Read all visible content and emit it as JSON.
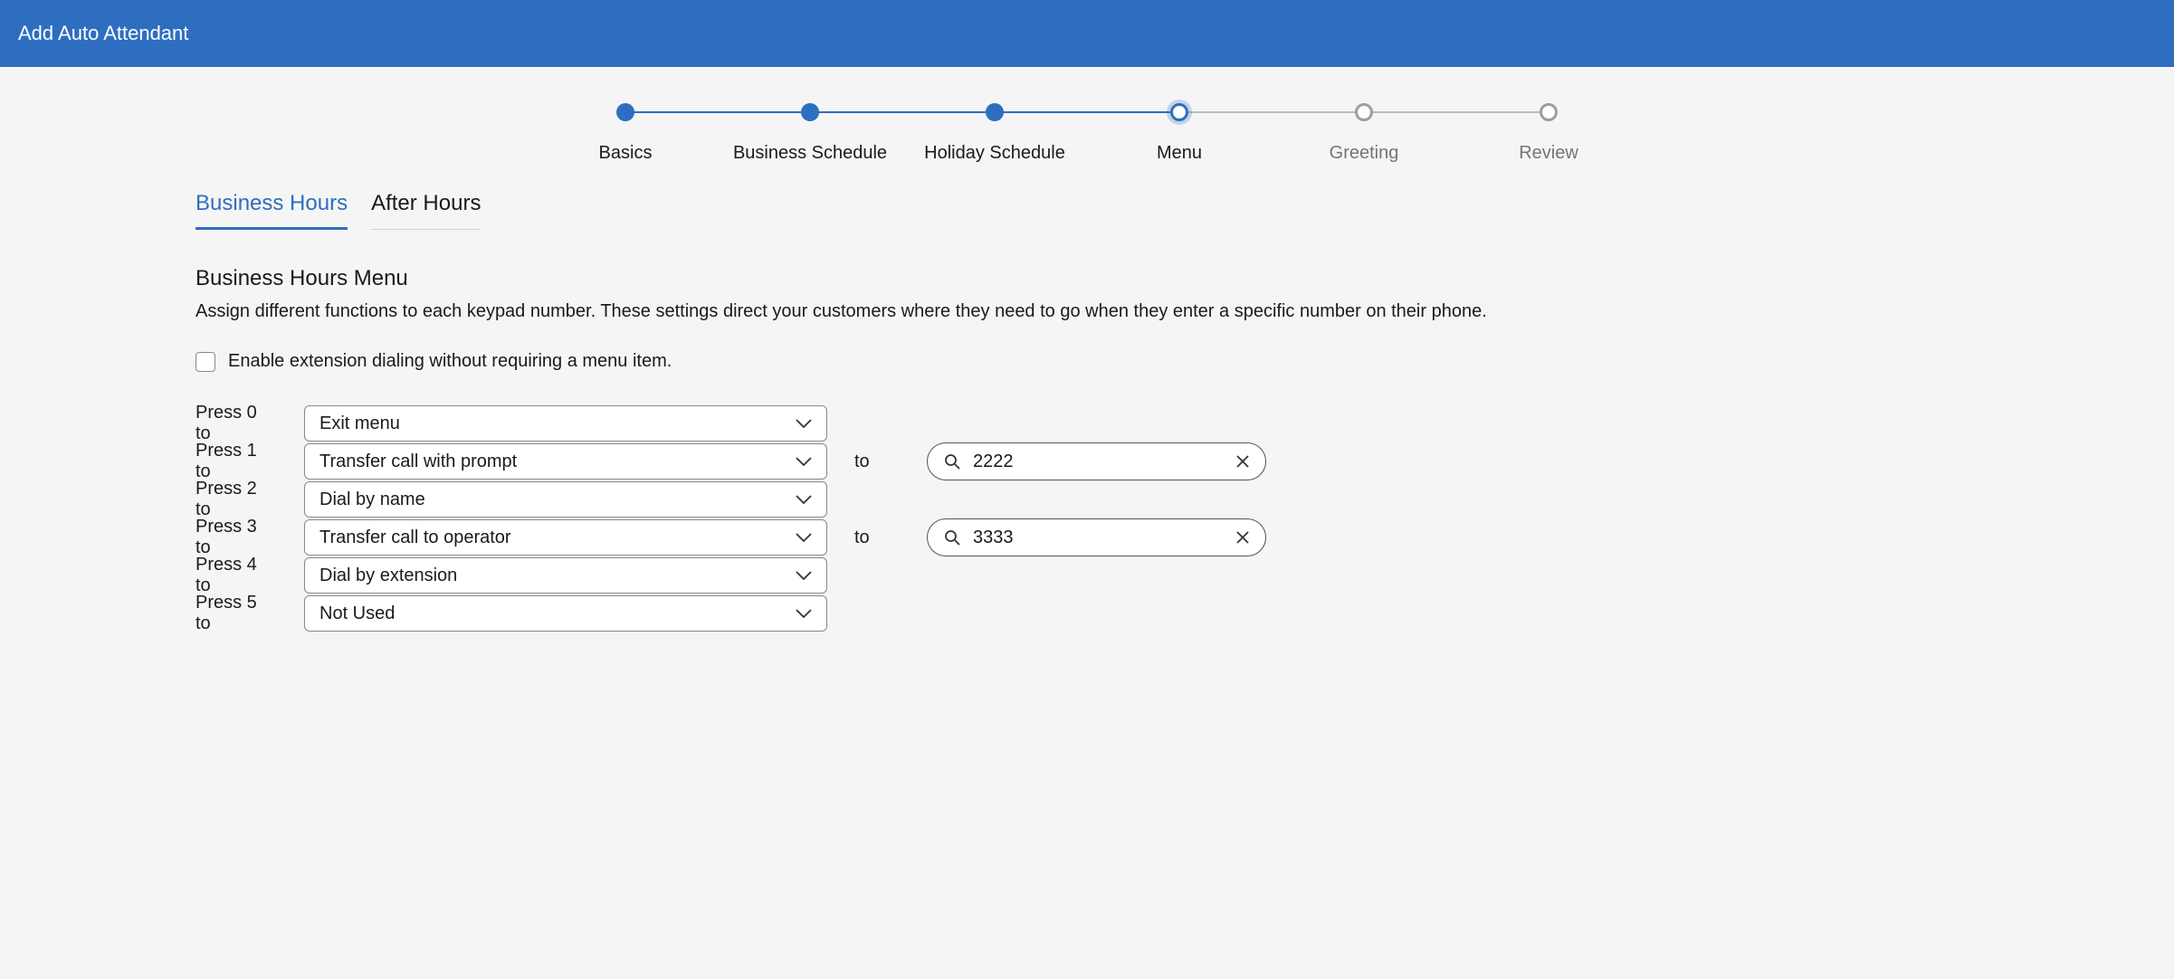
{
  "header": {
    "title": "Add Auto Attendant"
  },
  "stepper": {
    "steps": [
      {
        "label": "Basics",
        "state": "done"
      },
      {
        "label": "Business Schedule",
        "state": "done"
      },
      {
        "label": "Holiday Schedule",
        "state": "done"
      },
      {
        "label": "Menu",
        "state": "current"
      },
      {
        "label": "Greeting",
        "state": "future"
      },
      {
        "label": "Review",
        "state": "future"
      }
    ]
  },
  "tabs": {
    "items": [
      {
        "label": "Business Hours",
        "active": true
      },
      {
        "label": "After Hours",
        "active": false
      }
    ]
  },
  "section": {
    "title": "Business Hours Menu",
    "description": "Assign different functions to each keypad number. These settings direct your customers where they need to go when they enter a specific number on their phone."
  },
  "checkbox": {
    "label": "Enable extension dialing without requiring a menu item.",
    "checked": false
  },
  "to_label": "to",
  "rows": [
    {
      "press": "Press 0 to",
      "action": "Exit menu",
      "has_target": false
    },
    {
      "press": "Press 1 to",
      "action": "Transfer call with prompt",
      "has_target": true,
      "target": "2222"
    },
    {
      "press": "Press 2 to",
      "action": "Dial by name",
      "has_target": false
    },
    {
      "press": "Press 3 to",
      "action": "Transfer call to operator",
      "has_target": true,
      "target": "3333"
    },
    {
      "press": "Press 4 to",
      "action": "Dial by extension",
      "has_target": false
    },
    {
      "press": "Press 5 to",
      "action": "Not Used",
      "has_target": false
    }
  ]
}
